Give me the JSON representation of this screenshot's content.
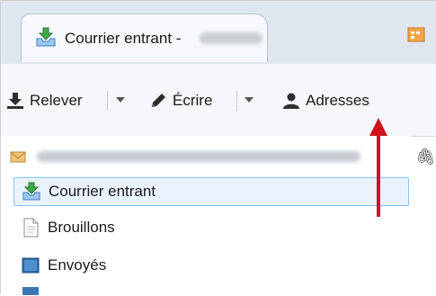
{
  "tab": {
    "title": "Courrier entrant -"
  },
  "toolbar": {
    "get_mail_label": "Relever",
    "write_label": "Écrire",
    "address_book_label": "Adresses"
  },
  "folders": [
    {
      "label": "Courrier entrant",
      "icon": "inbox-icon",
      "selected": true
    },
    {
      "label": "Brouillons",
      "icon": "drafts-icon",
      "selected": false
    },
    {
      "label": "Envoyés",
      "icon": "sent-icon",
      "selected": false
    }
  ],
  "colors": {
    "selection_border": "#8fc0ef",
    "selection_fill": "#eaf3fd",
    "annotation_arrow": "#d0141e"
  }
}
